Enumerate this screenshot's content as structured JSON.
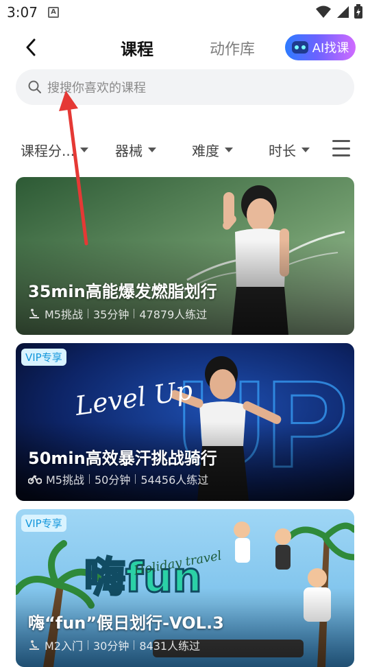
{
  "status_bar": {
    "time": "3:07",
    "notification_letter": "A"
  },
  "header": {
    "tabs": [
      {
        "label": "课程"
      },
      {
        "label": "动作库"
      }
    ],
    "ai_button_label": "AI找课"
  },
  "search": {
    "placeholder": "搜搜你喜欢的课程"
  },
  "filters": [
    {
      "label": "课程分..."
    },
    {
      "label": "器械"
    },
    {
      "label": "难度"
    },
    {
      "label": "时长"
    }
  ],
  "courses": [
    {
      "title": "35min高能爆发燃脂划行",
      "equipment": "M5挑战",
      "duration": "35分钟",
      "participants": "47879人练过",
      "vip": ""
    },
    {
      "title": "50min高效暴汗挑战骑行",
      "equipment": "M5挑战",
      "duration": "50分钟",
      "participants": "54456人练过",
      "vip": "VIP专享",
      "art_text": "Level Up"
    },
    {
      "title": "嗨“fun”假日划行-VOL.3",
      "equipment": "M2入门",
      "duration": "30分钟",
      "participants": "8431人练过",
      "vip": "VIP专享",
      "art_text": "Holiday travel"
    }
  ],
  "colors": {
    "accent_red": "#e53935",
    "ai_gradient_start": "#2d7bff",
    "ai_gradient_end": "#d06bff"
  }
}
